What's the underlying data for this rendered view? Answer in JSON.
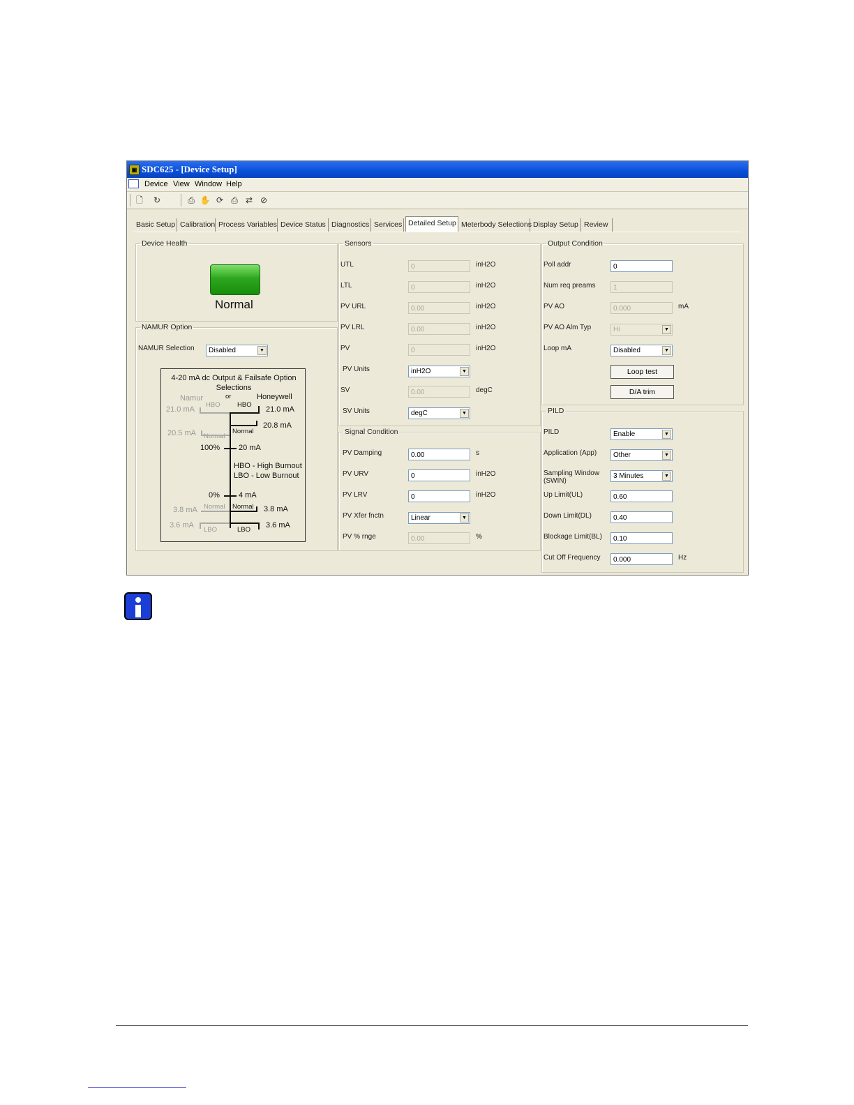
{
  "window": {
    "title": "SDC625 - [Device Setup]",
    "app_icon": "sdc625-icon"
  },
  "menu": [
    "Device",
    "View",
    "Window",
    "Help"
  ],
  "toolbar": {
    "icons": [
      "new-icon",
      "open-icon",
      "print-preview-icon",
      "hand-icon",
      "refresh-icon",
      "printer-icon",
      "sync-icon",
      "stop-icon"
    ]
  },
  "tabs": [
    "Basic Setup",
    "Calibration",
    "Process Variables",
    "Device Status",
    "Diagnostics",
    "Services",
    "Detailed Setup",
    "Meterbody Selections",
    "Display Setup",
    "Review"
  ],
  "active_tab": "Detailed Setup",
  "device_health": {
    "legend": "Device Health",
    "status": "Normal",
    "color": "#2fa61f"
  },
  "namur": {
    "legend": "NAMUR Option",
    "selection_label": "NAMUR Selection",
    "selection_value": "Disabled",
    "diagram": {
      "title": "4-20 mA dc Output & Failsafe Option Selections",
      "namur": "Namur",
      "or": "or",
      "honeywell": "Honeywell",
      "namur_21": "21.0 mA",
      "hbo_left": "HBO",
      "hbo_right": "HBO",
      "hw_21": "21.0 mA",
      "hw_208": "20.8 mA",
      "normal_hw_top": "Normal",
      "namur_205": "20.5 mA",
      "normal_namur_top": "Normal",
      "pct100": "100%",
      "ma20": "20 mA",
      "hbo_legend": "HBO - High Burnout",
      "lbo_legend": "LBO - Low Burnout",
      "pct0": "0%",
      "ma4": "4 mA",
      "namur_38": "3.8 mA",
      "normal_namur_bot": "Normal",
      "normal_hw_bot": "Normal",
      "hw_38": "3.8 mA",
      "namur_36": "3.6 mA",
      "lbo_left": "LBO",
      "lbo_right": "LBO",
      "hw_36": "3.6 mA"
    }
  },
  "sensors": {
    "legend": "Sensors",
    "rows": [
      {
        "label": "UTL",
        "value": "0",
        "unit": "inH2O"
      },
      {
        "label": "LTL",
        "value": "0",
        "unit": "inH2O"
      },
      {
        "label": "PV URL",
        "value": "0.00",
        "unit": "inH2O"
      },
      {
        "label": "PV LRL",
        "value": "0.00",
        "unit": "inH2O"
      },
      {
        "label": "PV",
        "value": "0",
        "unit": "inH2O"
      },
      {
        "label": "PV Units",
        "value": "inH2O",
        "unit": ""
      },
      {
        "label": "SV",
        "value": "0.00",
        "unit": "degC"
      },
      {
        "label": "SV Units",
        "value": "degC",
        "unit": ""
      }
    ]
  },
  "signal_condition": {
    "legend": "Signal Condition",
    "rows": [
      {
        "label": "PV Damping",
        "value": "0.00",
        "unit": "s"
      },
      {
        "label": "PV URV",
        "value": "0",
        "unit": "inH2O"
      },
      {
        "label": "PV LRV",
        "value": "0",
        "unit": "inH2O"
      },
      {
        "label": "PV Xfer fnctn",
        "value": "Linear",
        "unit": ""
      },
      {
        "label": "PV % rnge",
        "value": "0.00",
        "unit": "%"
      }
    ]
  },
  "output_condition": {
    "legend": "Output Condition",
    "rows": [
      {
        "label": "Poll addr",
        "value": "0",
        "unit": ""
      },
      {
        "label": "Num req preams",
        "value": "1",
        "unit": ""
      },
      {
        "label": "PV AO",
        "value": "0.000",
        "unit": "mA"
      },
      {
        "label": "PV AO Alm Typ",
        "value": "Hi",
        "unit": ""
      },
      {
        "label": "Loop mA",
        "value": "Disabled",
        "unit": ""
      }
    ],
    "loop_test_label": "Loop test",
    "da_trim_label": "D/A trim"
  },
  "pild": {
    "legend": "PILD",
    "rows": [
      {
        "label": "PILD",
        "value": "Enable",
        "unit": ""
      },
      {
        "label": "Application (App)",
        "value": "Other",
        "unit": ""
      },
      {
        "label": "Sampling Window (SWIN)",
        "value": "3 Minutes",
        "unit": ""
      },
      {
        "label": "Up Limit(UL)",
        "value": "0.60",
        "unit": ""
      },
      {
        "label": "Down Limit(DL)",
        "value": "0.40",
        "unit": ""
      },
      {
        "label": "Blockage Limit(BL)",
        "value": "0.10",
        "unit": ""
      },
      {
        "label": "Cut Off Frequency",
        "value": "0.000",
        "unit": "Hz"
      }
    ]
  },
  "page": {
    "info_icon": "information-icon"
  }
}
